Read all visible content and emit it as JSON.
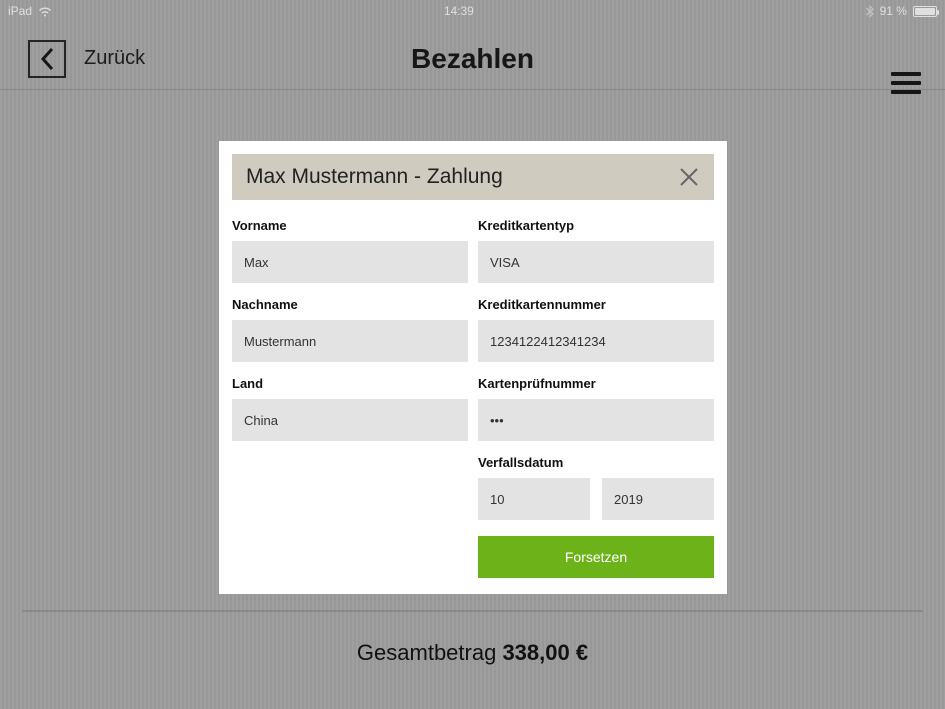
{
  "status": {
    "device": "iPad",
    "time": "14:39",
    "battery_pct": "91 %"
  },
  "header": {
    "back_label": "Zurück",
    "title": "Bezahlen"
  },
  "modal": {
    "title": "Max Mustermann - Zahlung",
    "fields": {
      "firstname_label": "Vorname",
      "firstname_value": "Max",
      "lastname_label": "Nachname",
      "lastname_value": "Mustermann",
      "country_label": "Land",
      "country_value": "China",
      "cardtype_label": "Kreditkartentyp",
      "cardtype_value": "VISA",
      "cardnumber_label": "Kreditkartennummer",
      "cardnumber_value": "1234122412341234",
      "cvv_label": "Kartenprüfnummer",
      "cvv_value": "•••",
      "expiry_label": "Verfallsdatum",
      "expiry_month": "10",
      "expiry_year": "2019"
    },
    "continue_label": "Forsetzen"
  },
  "footer": {
    "total_label": "Gesamtbetrag ",
    "total_value": "338,00 €"
  }
}
